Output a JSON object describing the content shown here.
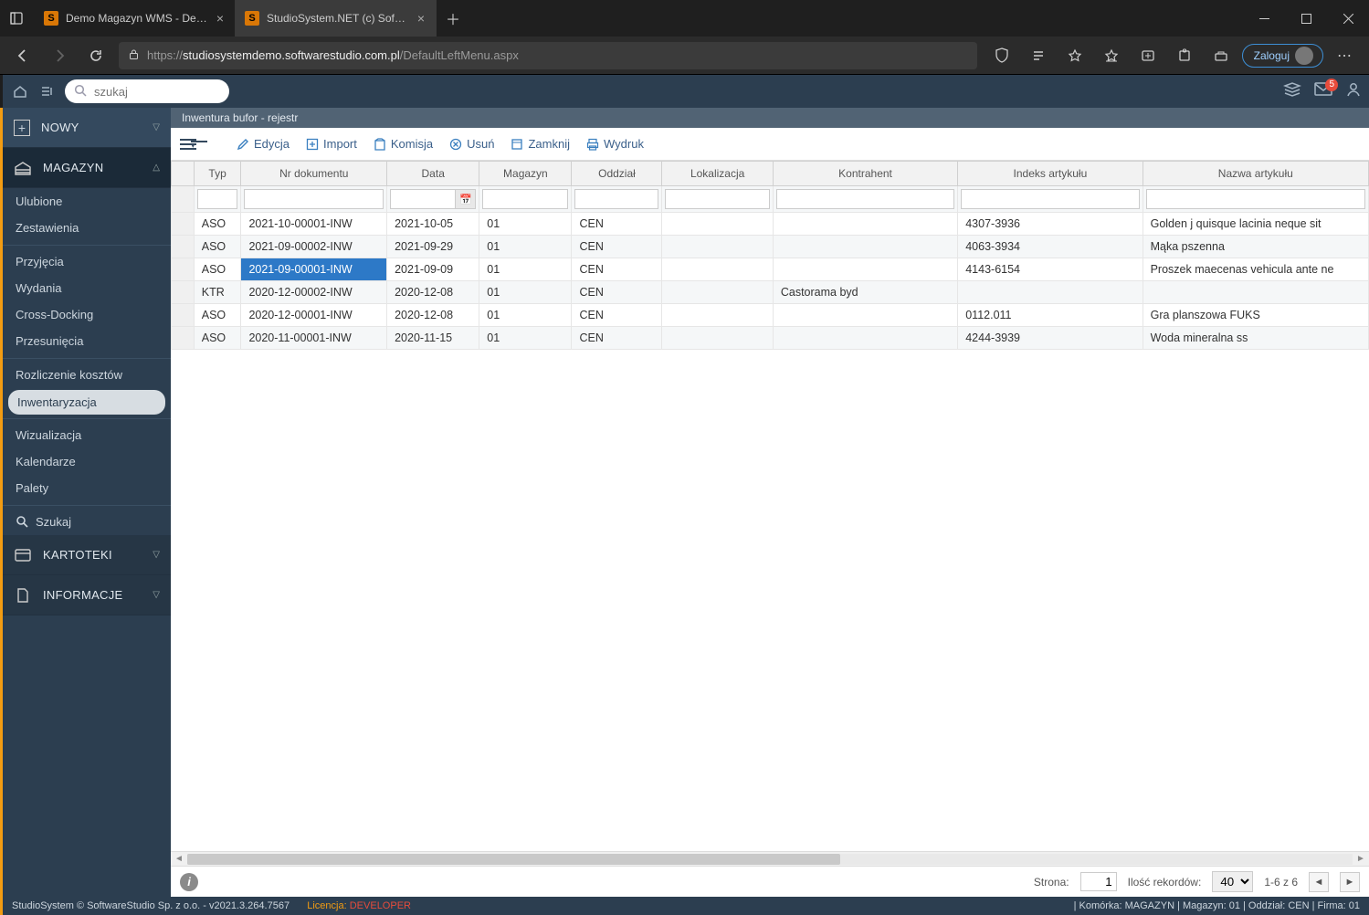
{
  "browser": {
    "tabs": [
      {
        "title": "Demo Magazyn WMS - Demo o",
        "active": false
      },
      {
        "title": "StudioSystem.NET (c) SoftwareSt",
        "active": true
      }
    ],
    "url_host": "studiosystemdemo.softwarestudio.com.pl",
    "url_path": "/DefaultLeftMenu.aspx",
    "url_protocol": "https://",
    "login": "Zaloguj"
  },
  "search_placeholder": "szukaj",
  "notif_count": "5",
  "sidebar": {
    "nowy": "NOWY",
    "magazyn": "MAGAZYN",
    "kartoteki": "KARTOTEKI",
    "informacje": "INFORMACJE",
    "items": [
      "Ulubione",
      "Zestawienia",
      "Przyjęcia",
      "Wydania",
      "Cross-Docking",
      "Przesunięcia",
      "Rozliczenie kosztów",
      "Inwentaryzacja",
      "Wizualizacja",
      "Kalendarze",
      "Palety",
      "Szukaj"
    ]
  },
  "page_title": "Inwentura bufor - rejestr",
  "toolbar": {
    "edycja": "Edycja",
    "import": "Import",
    "komisja": "Komisja",
    "usun": "Usuń",
    "zamknij": "Zamknij",
    "wydruk": "Wydruk"
  },
  "columns": {
    "typ": "Typ",
    "nr": "Nr dokumentu",
    "data": "Data",
    "magazyn": "Magazyn",
    "oddzial": "Oddział",
    "lokalizacja": "Lokalizacja",
    "kontrahent": "Kontrahent",
    "indeks": "Indeks artykułu",
    "nazwa": "Nazwa artykułu"
  },
  "rows": [
    {
      "typ": "ASO",
      "nr": "2021-10-00001-INW",
      "data": "2021-10-05",
      "mag": "01",
      "odd": "CEN",
      "lok": "",
      "kon": "",
      "idx": "4307-3936",
      "naz": "Golden j quisque lacinia neque sit"
    },
    {
      "typ": "ASO",
      "nr": "2021-09-00002-INW",
      "data": "2021-09-29",
      "mag": "01",
      "odd": "CEN",
      "lok": "",
      "kon": "",
      "idx": "4063-3934",
      "naz": "Mąka pszenna"
    },
    {
      "typ": "ASO",
      "nr": "2021-09-00001-INW",
      "data": "2021-09-09",
      "mag": "01",
      "odd": "CEN",
      "lok": "",
      "kon": "",
      "idx": "4143-6154",
      "naz": "Proszek maecenas vehicula ante ne"
    },
    {
      "typ": "KTR",
      "nr": "2020-12-00002-INW",
      "data": "2020-12-08",
      "mag": "01",
      "odd": "CEN",
      "lok": "",
      "kon": "Castorama byd",
      "idx": "",
      "naz": ""
    },
    {
      "typ": "ASO",
      "nr": "2020-12-00001-INW",
      "data": "2020-12-08",
      "mag": "01",
      "odd": "CEN",
      "lok": "",
      "kon": "",
      "idx": "0112.011",
      "naz": "Gra planszowa FUKS"
    },
    {
      "typ": "ASO",
      "nr": "2020-11-00001-INW",
      "data": "2020-11-15",
      "mag": "01",
      "odd": "CEN",
      "lok": "",
      "kon": "",
      "idx": "4244-3939",
      "naz": "Woda mineralna ss"
    }
  ],
  "selected_cell": {
    "row": 2,
    "col": "nr"
  },
  "footer": {
    "strona": "Strona:",
    "page": "1",
    "ilosc": "Ilość rekordów:",
    "page_size": "40",
    "range": "1-6 z 6"
  },
  "status": {
    "left": "StudioSystem © SoftwareStudio Sp. z o.o. - v2021.3.264.7567",
    "lic_label": "Licencja: ",
    "lic_val": "DEVELOPER",
    "right": "| Komórka: MAGAZYN | Magazyn: 01 | Oddział: CEN | Firma: 01"
  }
}
